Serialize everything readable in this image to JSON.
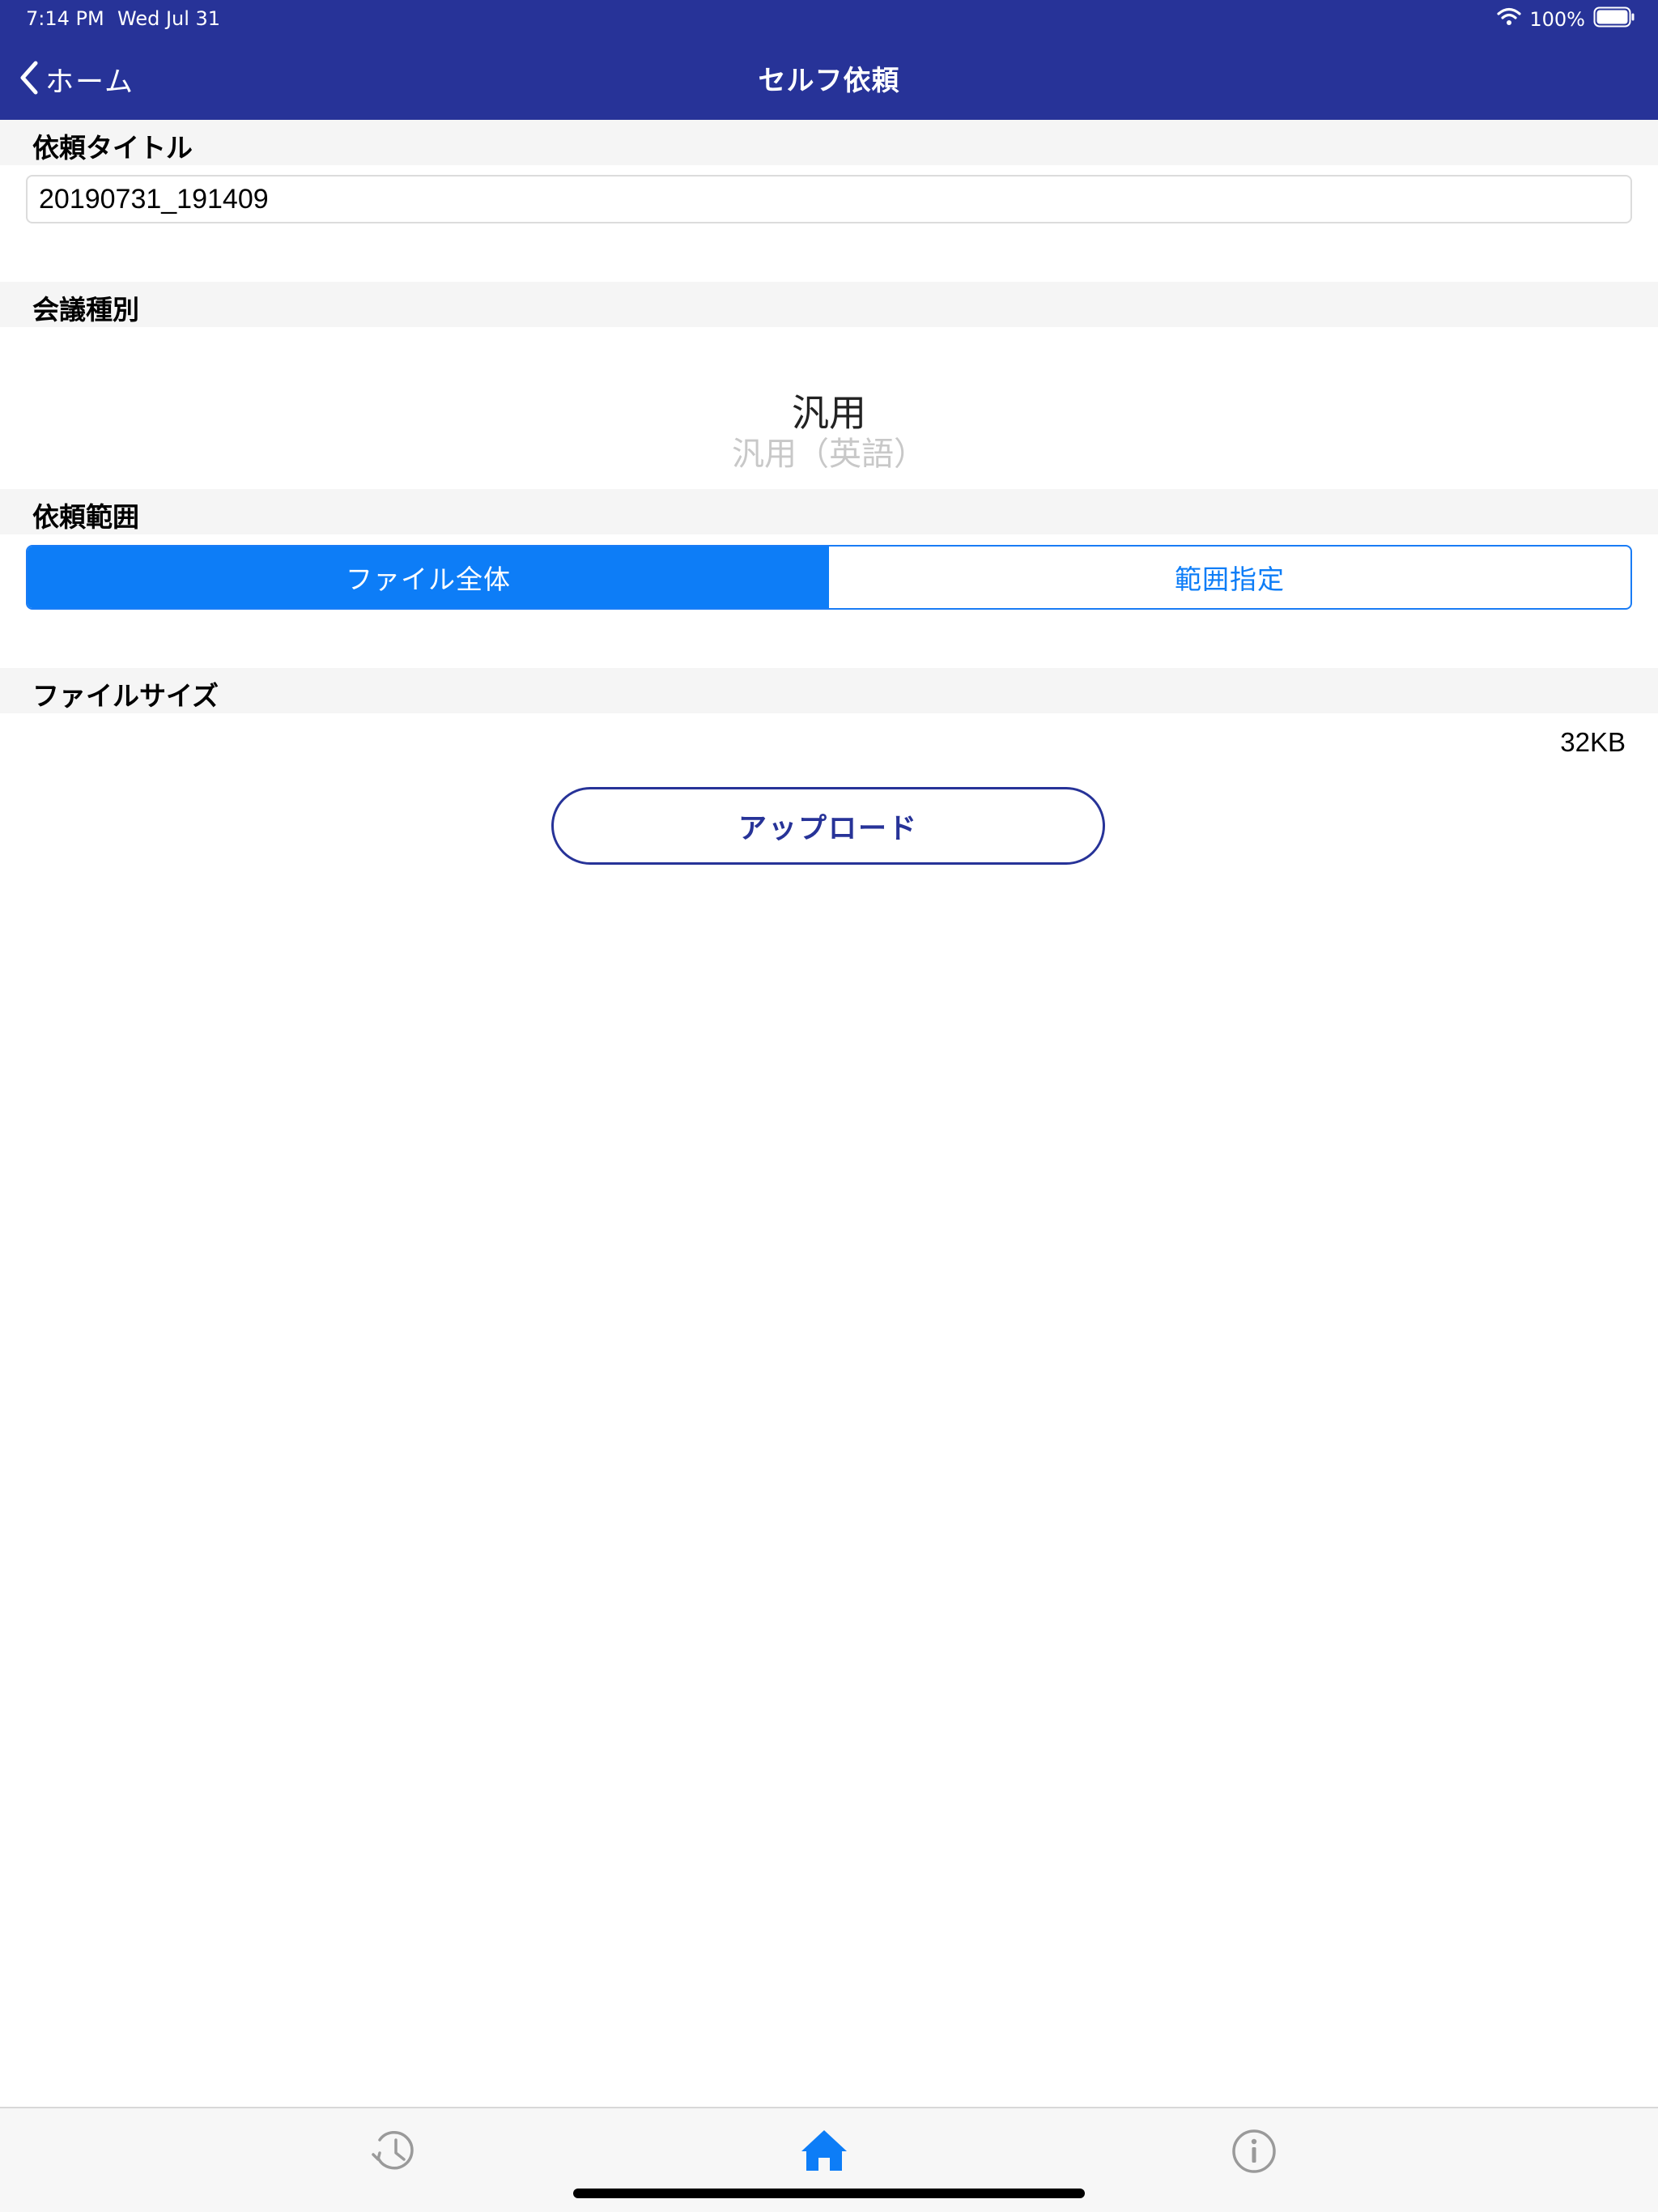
{
  "status_bar": {
    "time": "7:14 PM",
    "date": "Wed Jul 31",
    "battery_percent": "100%",
    "wifi_icon": "wifi-icon",
    "battery_icon": "battery-icon"
  },
  "nav": {
    "back_label": "ホーム",
    "back_icon": "chevron-left-icon",
    "title": "セルフ依頼"
  },
  "sections": {
    "request_title": {
      "header": "依頼タイトル",
      "value": "20190731_191409"
    },
    "meeting_type": {
      "header": "会議種別",
      "selected": "汎用",
      "next_option": "汎用（英語）"
    },
    "request_scope": {
      "header": "依頼範囲",
      "segments": [
        "ファイル全体",
        "範囲指定"
      ],
      "selected_index": 0
    },
    "file_size": {
      "header": "ファイルサイズ",
      "value": "32KB"
    }
  },
  "upload_button_label": "アップロード",
  "tab_bar": {
    "tabs": [
      {
        "icon": "history-clock-icon",
        "active": false
      },
      {
        "icon": "home-icon",
        "active": true
      },
      {
        "icon": "info-icon",
        "active": false
      }
    ]
  },
  "colors": {
    "nav_background": "#273398",
    "accent_blue": "#0d7df7",
    "section_background": "#f5f5f5",
    "tab_inactive": "#9a9a9a"
  }
}
